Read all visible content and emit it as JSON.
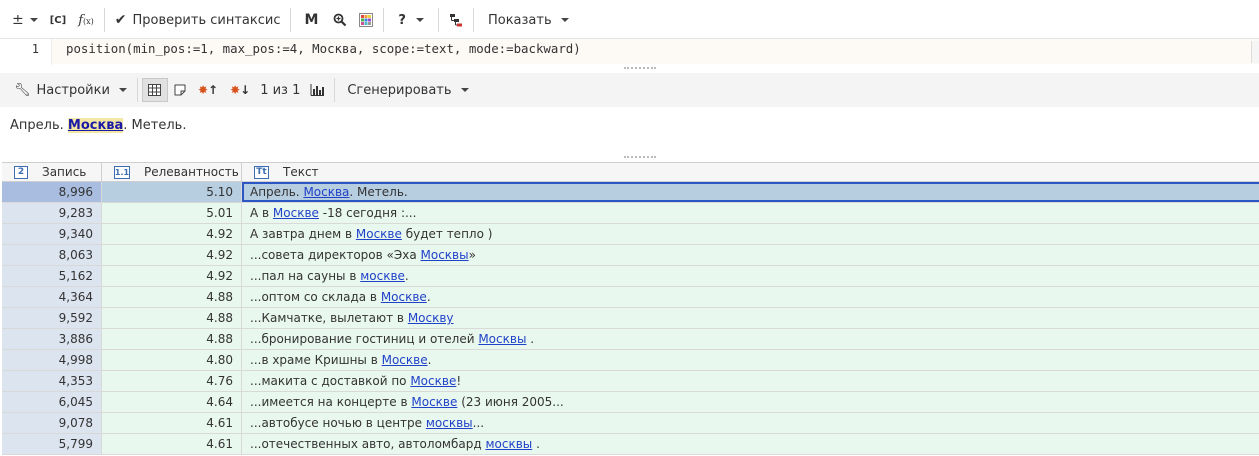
{
  "toolbar": {
    "plusminus": "±",
    "context_c": "[C]",
    "fx": "f(x)",
    "check_syntax": "Проверить синтаксис",
    "m_label": "M",
    "help": "?",
    "show": "Показать"
  },
  "editor": {
    "line_number": "1",
    "code": "position(min_pos:=1, max_pos:=4, Москва, scope:=text, mode:=backward)"
  },
  "results_toolbar": {
    "settings": "Настройки",
    "pager": "1 из 1",
    "generate": "Сгенерировать"
  },
  "preview": {
    "before": "Апрель. ",
    "highlight": "Москва",
    "after": ". Метель."
  },
  "grid": {
    "columns": [
      {
        "badge": "2",
        "label": "Запись"
      },
      {
        "badge": "1.1",
        "label": "Релевантность"
      },
      {
        "badge": "Tt",
        "label": "Текст"
      }
    ],
    "rows": [
      {
        "record": "8,996",
        "relevance": "5.10",
        "pre": "Апрель. ",
        "link": "Москва",
        "post": ". Метель.",
        "selected": true
      },
      {
        "record": "9,283",
        "relevance": "5.01",
        "pre": "А в ",
        "link": "Москве",
        "post": " -18 сегодня :..."
      },
      {
        "record": "9,340",
        "relevance": "4.92",
        "pre": "А завтра днем в ",
        "link": "Москве",
        "post": " будет тепло )"
      },
      {
        "record": "8,063",
        "relevance": "4.92",
        "pre": "...совета директоров «Эха ",
        "link": "Москвы",
        "post": "»"
      },
      {
        "record": "5,162",
        "relevance": "4.92",
        "pre": "...пал на сауны в ",
        "link": "москве",
        "post": "."
      },
      {
        "record": "4,364",
        "relevance": "4.88",
        "pre": "...оптом со склада в ",
        "link": "Москве",
        "post": "."
      },
      {
        "record": "9,592",
        "relevance": "4.88",
        "pre": "...Камчатке, вылетают в ",
        "link": "Москву",
        "post": ""
      },
      {
        "record": "3,886",
        "relevance": "4.88",
        "pre": "...бронирование гостиниц и отелей ",
        "link": "Москвы",
        "post": " ."
      },
      {
        "record": "4,998",
        "relevance": "4.80",
        "pre": "...в храме Кришны в ",
        "link": "Москве",
        "post": "."
      },
      {
        "record": "4,353",
        "relevance": "4.76",
        "pre": "...макита с доставкой по ",
        "link": "Москве",
        "post": "!"
      },
      {
        "record": "6,045",
        "relevance": "4.64",
        "pre": "...имеется на концерте в ",
        "link": "Москве",
        "post": " (23 июня 2005..."
      },
      {
        "record": "9,078",
        "relevance": "4.61",
        "pre": "...автобусе ночью в центре ",
        "link": "москвы",
        "post": "..."
      },
      {
        "record": "5,799",
        "relevance": "4.61",
        "pre": "...отечественных авто, автоломбард ",
        "link": "москвы",
        "post": " ."
      }
    ]
  }
}
